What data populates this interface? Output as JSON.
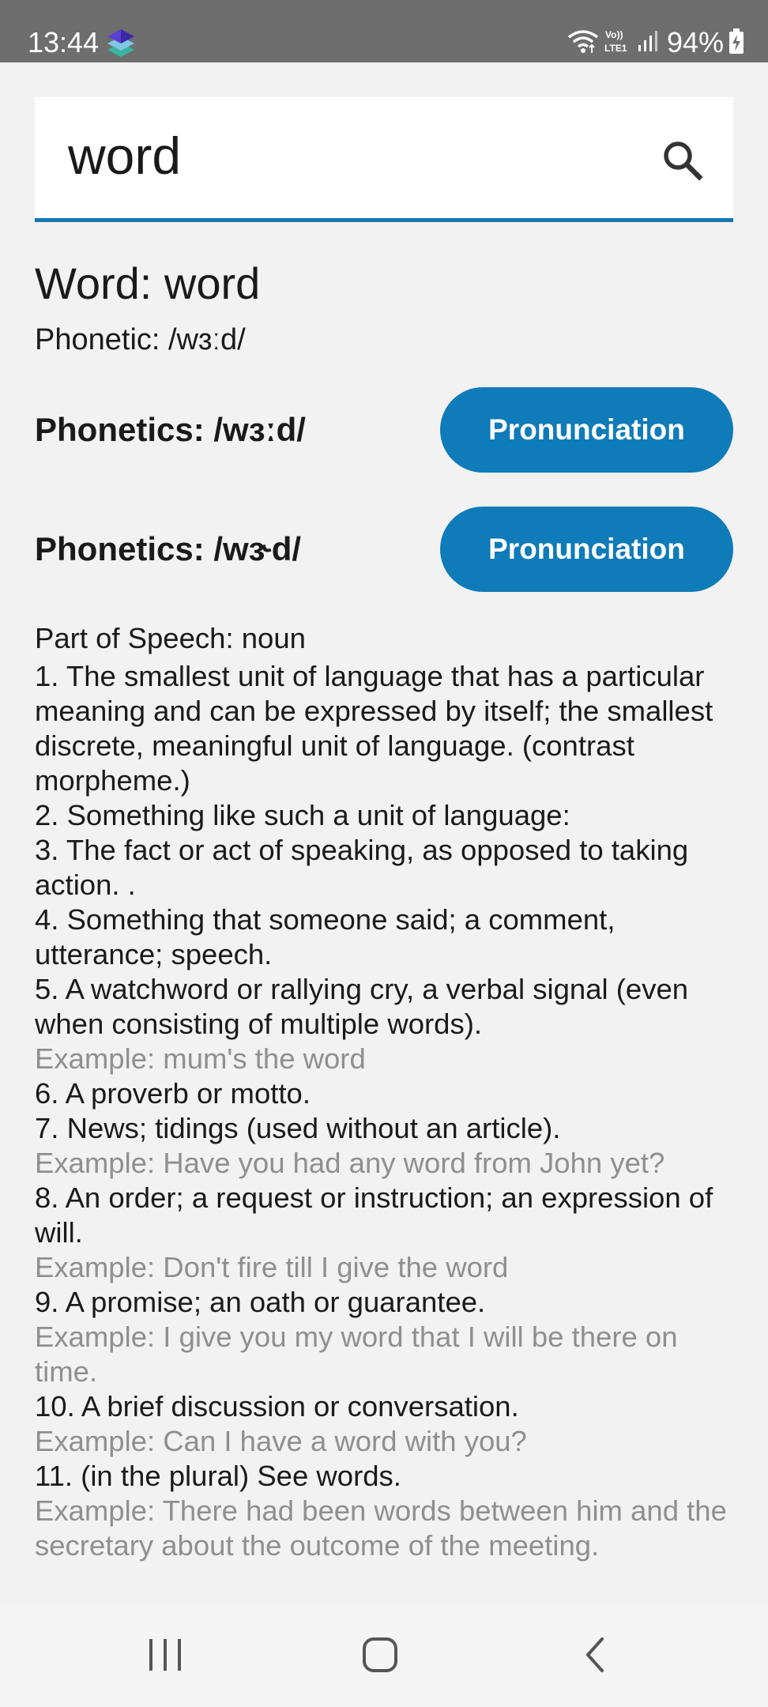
{
  "status_bar": {
    "time": "13:44",
    "battery_percent": "94%",
    "network_label": "Vo)) LTE1",
    "icons": [
      "app-stack-icon",
      "wifi-icon",
      "lte-icon",
      "signal-icon",
      "battery-charging-icon"
    ]
  },
  "search": {
    "value": "word",
    "underline_color": "#1777ad"
  },
  "entry": {
    "word_title": "Word: word",
    "phonetic": "Phonetic: /wɜːd/",
    "phonetics": [
      {
        "text": "Phonetics: /wɜːd/",
        "button_label": "Pronunciation"
      },
      {
        "text": "Phonetics: /wɝd/",
        "button_label": "Pronunciation"
      }
    ],
    "button_color": "#0f7bb8",
    "part_of_speech": "Part of Speech: noun",
    "definitions": [
      {
        "text": "1. The smallest unit of language that has a particular meaning and can be expressed by itself; the smallest discrete, meaningful unit of language. (contrast morpheme.)"
      },
      {
        "text": "2. Something like such a unit of language:"
      },
      {
        "text": "3. The fact or act of speaking, as opposed to taking action. ."
      },
      {
        "text": "4. Something that someone said; a comment, utterance; speech."
      },
      {
        "text": "5. A watchword or rallying cry, a verbal signal (even when consisting of multiple words).",
        "example": "Example: mum's the word"
      },
      {
        "text": "6. A proverb or motto."
      },
      {
        "text": "7. News; tidings (used without an article).",
        "example": "Example: Have you had any word from John yet?"
      },
      {
        "text": "8. An order; a request or instruction; an expression of will.",
        "example": "Example: Don't fire till I give the word"
      },
      {
        "text": "9. A promise; an oath or guarantee.",
        "example": "Example: I give you my word that I will be there on time."
      },
      {
        "text": "10. A brief discussion or conversation.",
        "example": "Example: Can I have a word with you?"
      },
      {
        "text": "11. (in the plural) See words.",
        "example": "Example: There had been words between him and the secretary about the outcome of the meeting."
      }
    ],
    "example_color": "#8f8f8f"
  },
  "nav_bar": {
    "buttons": [
      "recents-icon",
      "home-icon",
      "back-icon"
    ]
  }
}
